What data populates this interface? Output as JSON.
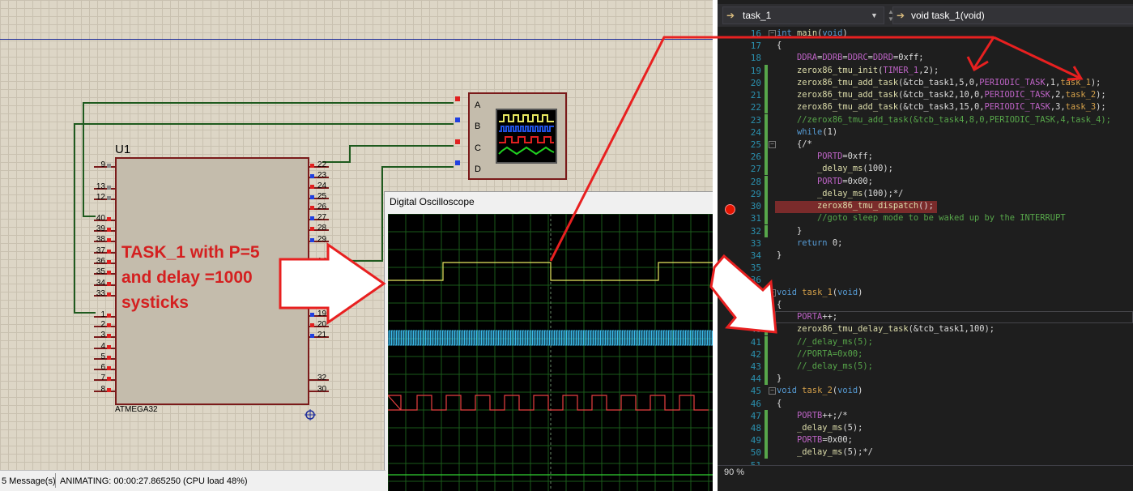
{
  "simulator": {
    "chip_ref": "U1",
    "chip_name": "ATMEGA32",
    "left_pins": [
      "9",
      "13",
      "12",
      "40",
      "39",
      "38",
      "37",
      "36",
      "35",
      "34",
      "33",
      "1",
      "2",
      "3",
      "4",
      "5",
      "6",
      "7",
      "8"
    ],
    "right_pins": [
      "22",
      "23",
      "24",
      "25",
      "26",
      "27",
      "28",
      "29",
      "14",
      "19",
      "20",
      "21",
      "32",
      "30"
    ],
    "scope_channels": [
      "A",
      "B",
      "C",
      "D"
    ],
    "annotation": [
      "TASK_1 with P=5",
      "and delay =1000",
      "systicks"
    ]
  },
  "oscilloscope": {
    "title": "Digital Oscilloscope",
    "colors": {
      "channel_a": "#e8e860",
      "channel_b": "#3ab8e8",
      "channel_c": "#e84040",
      "channel_d": "#30d030"
    }
  },
  "status": {
    "messages": "5 Message(s)",
    "animating": "ANIMATING: 00:00:27.865250 (CPU load 48%)"
  },
  "editor": {
    "scope_dropdown": "task_1",
    "function_dropdown": "void task_1(void)",
    "zoom": "90 %",
    "lines": [
      {
        "n": "16",
        "t": "int main(void)"
      },
      {
        "n": "17",
        "t": "{"
      },
      {
        "n": "18",
        "t": "    DDRA=DDRB=DDRC=DDRD=0xff;"
      },
      {
        "n": "19",
        "t": "    zerox86_tmu_init(TIMER_1,2);"
      },
      {
        "n": "20",
        "t": "    zerox86_tmu_add_task(&tcb_task1,5,0,PERIODIC_TASK,1,task_1);"
      },
      {
        "n": "21",
        "t": "    zerox86_tmu_add_task(&tcb_task2,10,0,PERIODIC_TASK,2,task_2);"
      },
      {
        "n": "22",
        "t": "    zerox86_tmu_add_task(&tcb_task3,15,0,PERIODIC_TASK,3,task_3);"
      },
      {
        "n": "23",
        "t": "    //zerox86_tmu_add_task(&tcb_task4,8,0,PERIODIC_TASK,4,task_4);"
      },
      {
        "n": "24",
        "t": "    while(1)"
      },
      {
        "n": "25",
        "t": "    {/*"
      },
      {
        "n": "26",
        "t": "        PORTD=0xff;"
      },
      {
        "n": "27",
        "t": "        _delay_ms(100);"
      },
      {
        "n": "28",
        "t": "        PORTD=0x00;"
      },
      {
        "n": "29",
        "t": "        _delay_ms(100);*/"
      },
      {
        "n": "30",
        "t": "        zerox86_tmu_dispatch();"
      },
      {
        "n": "31",
        "t": "        //goto sleep mode to be waked up by the INTERRUPT"
      },
      {
        "n": "32",
        "t": "    }"
      },
      {
        "n": "33",
        "t": "    return 0;"
      },
      {
        "n": "34",
        "t": "}"
      },
      {
        "n": "35",
        "t": ""
      },
      {
        "n": "36",
        "t": ""
      },
      {
        "n": "37",
        "t": "void task_1(void)"
      },
      {
        "n": "38",
        "t": "{"
      },
      {
        "n": "39",
        "t": "    PORTA++;"
      },
      {
        "n": "40",
        "t": "    zerox86_tmu_delay_task(&tcb_task1,100);"
      },
      {
        "n": "41",
        "t": "    //_delay_ms(5);"
      },
      {
        "n": "42",
        "t": "    //PORTA=0x00;"
      },
      {
        "n": "43",
        "t": "    //_delay_ms(5);"
      },
      {
        "n": "44",
        "t": "}"
      },
      {
        "n": "45",
        "t": "void task_2(void)"
      },
      {
        "n": "46",
        "t": "{"
      },
      {
        "n": "47",
        "t": "    PORTB++;/*"
      },
      {
        "n": "48",
        "t": "    _delay_ms(5);"
      },
      {
        "n": "49",
        "t": "    PORTB=0x00;"
      },
      {
        "n": "50",
        "t": "    _delay_ms(5);*/"
      },
      {
        "n": "51",
        "t": ""
      }
    ]
  }
}
